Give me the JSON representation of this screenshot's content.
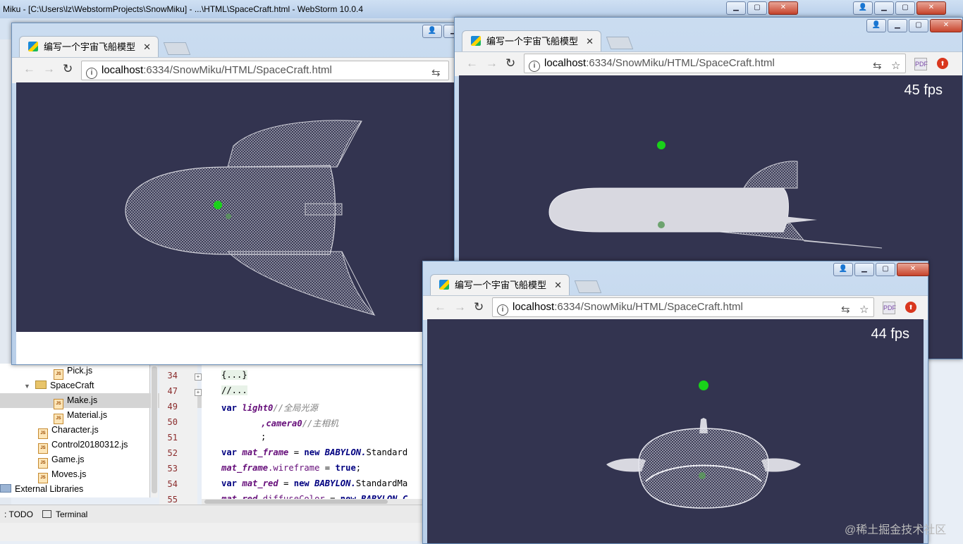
{
  "webstorm": {
    "title": "Miku - [C:\\Users\\lz\\WebstormProjects\\SnowMiku] - ...\\HTML\\SpaceCraft.html - WebStorm 10.0.4",
    "tree": [
      {
        "label": "Pick.js",
        "type": "file"
      },
      {
        "label": "SpaceCraft",
        "type": "folder"
      },
      {
        "label": "Make.js",
        "type": "file",
        "selected": true
      },
      {
        "label": "Material.js",
        "type": "file"
      },
      {
        "label": "Character.js",
        "type": "file"
      },
      {
        "label": "Control20180312.js",
        "type": "file"
      },
      {
        "label": "Game.js",
        "type": "file"
      },
      {
        "label": "Moves.js",
        "type": "file"
      },
      {
        "label": "External Libraries",
        "type": "library"
      }
    ],
    "line_numbers": [
      "34",
      "47",
      "49",
      "50",
      "51",
      "52",
      "53",
      "54",
      "55"
    ],
    "code": {
      "l34": "{...}",
      "l47": "//...",
      "l49_kw": "var ",
      "l49_var": "light0",
      "l49_cmt": "//全局光源",
      "l50_var": ",camera0",
      "l50_cmt": "//主相机",
      "l51": ";",
      "l52_kw": "var ",
      "l52_var": "mat_frame",
      "l52_eq": " = ",
      "l52_new": "new ",
      "l52_cls": "BABYLON.",
      "l52_cls2": "Standard",
      "l53_var": "mat_frame",
      "l53_prop": ".wireframe",
      "l53_eq": " = ",
      "l53_true": "true",
      "l53_end": ";",
      "l54_kw": "var ",
      "l54_var": "mat_red",
      "l54_eq": " = ",
      "l54_new": "new ",
      "l54_cls": "BABYLON.",
      "l54_cls2": "StandardMa",
      "l55_var": "mat_red",
      "l55_prop": ".diffuseColor",
      "l55_eq": " = ",
      "l55_new": "new ",
      "l55_cls": "BABYLON.C"
    },
    "status": {
      "todo": "TODO",
      "terminal": "Terminal"
    }
  },
  "browsers": [
    {
      "tab_title": "编写一个宇宙飞船模型",
      "url_host": "localhost",
      "url_path": ":6334/SnowMiku/HTML/SpaceCraft.html",
      "fps": ""
    },
    {
      "tab_title": "编写一个宇宙飞船模型",
      "url_host": "localhost",
      "url_path": ":6334/SnowMiku/HTML/SpaceCraft.html",
      "fps": "45 fps"
    },
    {
      "tab_title": "编写一个宇宙飞船模型",
      "url_host": "localhost",
      "url_path": ":6334/SnowMiku/HTML/SpaceCraft.html",
      "fps": "44 fps"
    }
  ],
  "watermark": "@稀土掘金技术社区",
  "icons": {
    "minimize": "minimize-icon",
    "maximize": "maximize-icon",
    "close": "close-icon"
  },
  "colors": {
    "viewport_bg": "#333450",
    "highlight_green": "#19d219"
  }
}
